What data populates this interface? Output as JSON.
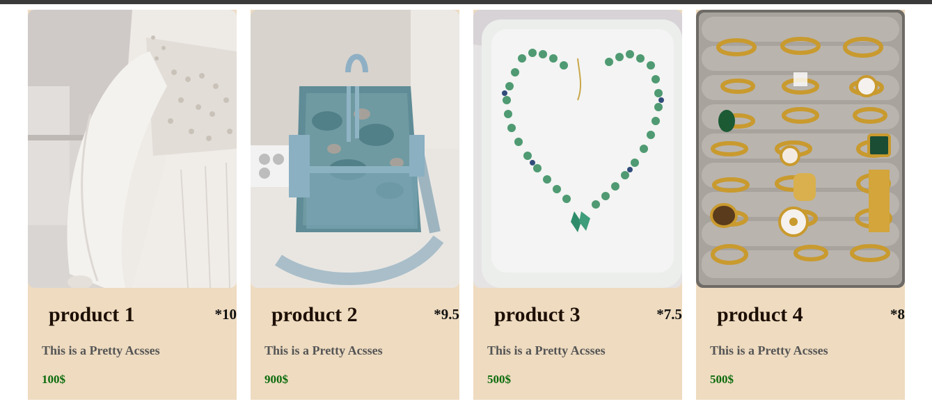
{
  "products": [
    {
      "name": "product 1",
      "rating": "*10",
      "description": "This is a Pretty Acsses",
      "price": "100$",
      "image_label": "white-dress-photo"
    },
    {
      "name": "product 2",
      "rating": "*9.5",
      "description": "This is a Pretty Acsses",
      "price": "900$",
      "image_label": "blue-backpack-photo"
    },
    {
      "name": "product 3",
      "rating": "*7.5",
      "description": "This is a Pretty Acsses",
      "price": "500$",
      "image_label": "green-necklace-photo"
    },
    {
      "name": "product 4",
      "rating": "*8",
      "description": "This is a Pretty Acsses",
      "price": "500$",
      "image_label": "gold-rings-photo"
    }
  ],
  "colors": {
    "card_background": "#eedbc0",
    "price_green": "#0b6b0b",
    "description_gray": "#555555",
    "top_bar": "#3a3a3a"
  }
}
